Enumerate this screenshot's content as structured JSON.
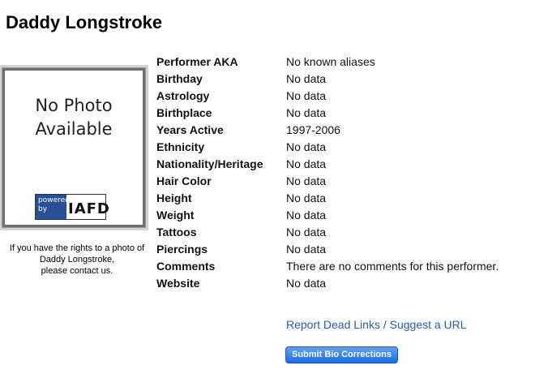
{
  "performer": {
    "name": "Daddy Longstroke"
  },
  "photo": {
    "placeholder_line1": "No Photo",
    "placeholder_line2": "Available",
    "badge_line1": "powered",
    "badge_line2": "by",
    "badge_brand": "IAFD"
  },
  "rights_notice": {
    "line1": "If you have the rights to a photo of",
    "line2": "Daddy Longstroke,",
    "line3": "please contact us."
  },
  "bio": [
    {
      "label": "Performer AKA",
      "value": "No known aliases"
    },
    {
      "label": "Birthday",
      "value": "No data"
    },
    {
      "label": "Astrology",
      "value": "No data"
    },
    {
      "label": "Birthplace",
      "value": "No data"
    },
    {
      "label": "Years Active",
      "value": "1997-2006"
    },
    {
      "label": "Ethnicity",
      "value": "No data"
    },
    {
      "label": "Nationality/Heritage",
      "value": "No data"
    },
    {
      "label": "Hair Color",
      "value": "No data"
    },
    {
      "label": "Height",
      "value": "No data"
    },
    {
      "label": "Weight",
      "value": "No data"
    },
    {
      "label": "Tattoos",
      "value": "No data"
    },
    {
      "label": "Piercings",
      "value": "No data"
    },
    {
      "label": "Comments",
      "value": "There are no comments for this performer."
    },
    {
      "label": "Website",
      "value": "No data"
    }
  ],
  "actions": {
    "report_link": "Report Dead Links / Suggest a URL",
    "submit_button": "Submit Bio Corrections"
  },
  "colors": {
    "link": "#2a5db0",
    "button": "#1d6ee4",
    "badge": "#2a4f99"
  }
}
